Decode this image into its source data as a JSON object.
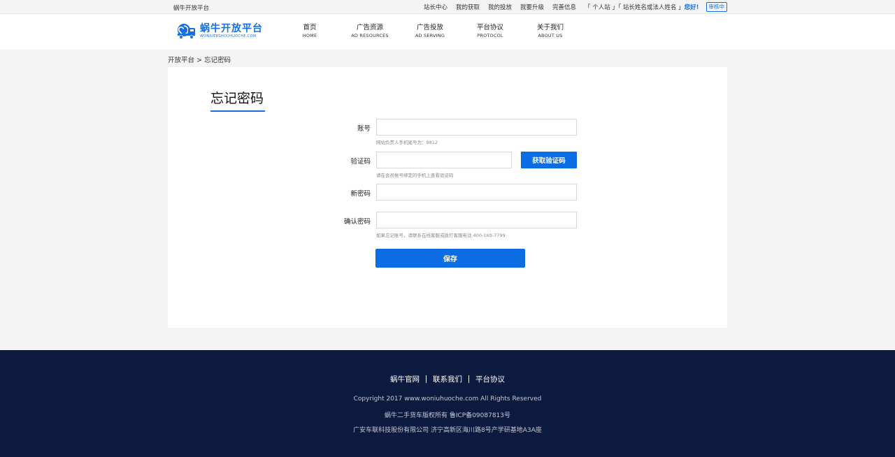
{
  "topbar": {
    "site": "蜗牛开放平台",
    "links": [
      "站长中心",
      "我的获取",
      "我的投放",
      "我要升级",
      "完善信息"
    ],
    "account_type": "「 个人站 」「 站长姓名或法人姓名 」",
    "greeting": "您好!",
    "status_badge": "审核中"
  },
  "logo": {
    "name": "蜗牛开放平台",
    "domain_text": "WONIUERSHOUHUOCHE.COM",
    "brand_color": "#1a6fdf"
  },
  "nav": [
    {
      "cn": "首页",
      "en": "HOME"
    },
    {
      "cn": "广告资源",
      "en": "AD RESOURCES"
    },
    {
      "cn": "广告投放",
      "en": "AD SERVING"
    },
    {
      "cn": "平台协议",
      "en": "PROTOCOL"
    },
    {
      "cn": "关于我们",
      "en": "ABOUT US"
    }
  ],
  "breadcrumb": "开放平台 > 忘记密码",
  "form": {
    "title": "忘记密码",
    "account_label": "账号",
    "account_value": "",
    "account_hint": "网站负责人手机尾号为：9812",
    "code_label": "验证码",
    "code_value": "",
    "code_button": "获取验证码",
    "code_hint": "请在会员帐号绑定的手机上查看验证码",
    "new_password_label": "新密码",
    "new_password_value": "",
    "confirm_label": "确认密码",
    "confirm_value": "",
    "confirm_hint": "如果忘记账号，请联系在线客服或拨打客服电话 400-169-7799",
    "save_button": "保存",
    "accent_color": "#0b6ce3"
  },
  "footer": {
    "links": [
      "蜗牛官网",
      "联系我们",
      "平台协议"
    ],
    "copyright": "Copyright 2017 www.woniuhuoche.com All Rights Reserved",
    "icp": "蜗牛二手货车版权所有 鲁ICP备09087813号",
    "address": "广安车联科技股份有限公司 济宁高新区海川路8号产学研基地A3A座",
    "background": "#0d1a3f"
  }
}
